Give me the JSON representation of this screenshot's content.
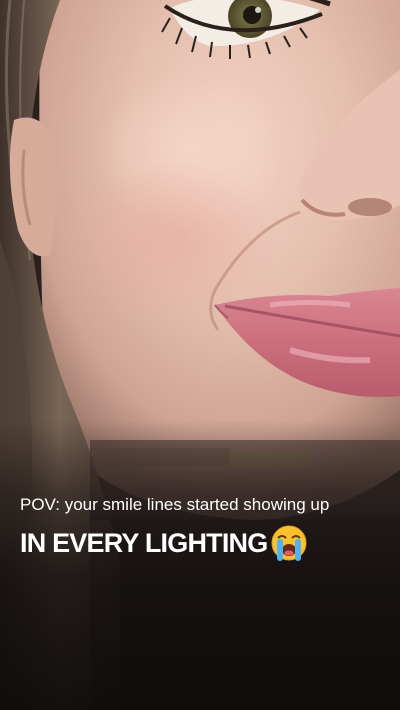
{
  "caption": {
    "line1": "POV: your smile lines started showing up",
    "line2": "IN EVERY LIGHTING"
  },
  "image": {
    "subject": "close-up-face-eye-nose-lips",
    "emoji_icon": "loudly-crying-face-icon",
    "colors": {
      "skin": "#e4bfae",
      "lips": "#d0737f",
      "hair": "#6b5a4e",
      "shadow": "#1a1413",
      "caption_text": "#ffffff"
    }
  }
}
